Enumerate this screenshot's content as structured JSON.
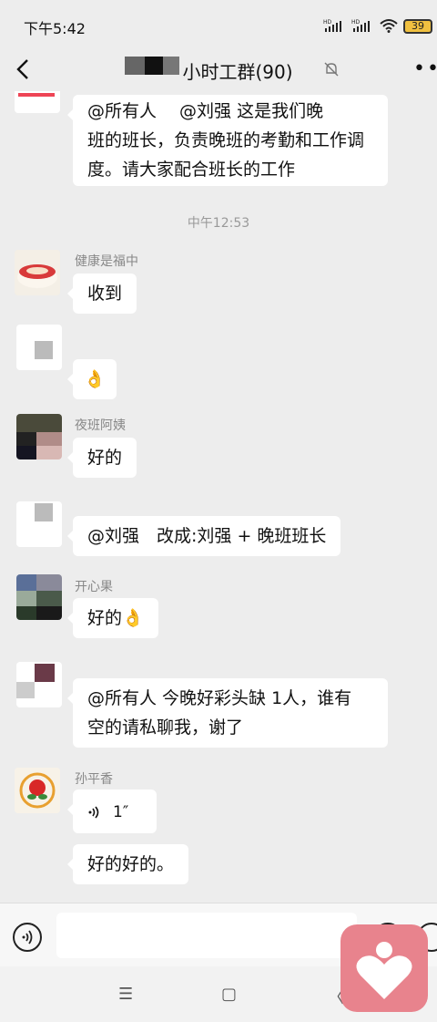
{
  "status_bar": {
    "time": "下午5:42",
    "signal1": "HD",
    "signal2": "HD",
    "battery": "39"
  },
  "header": {
    "title": "小时工群(90)"
  },
  "messages": [
    {
      "type": "text",
      "text": "@所有人　 @刘强  这是我们晚班的班长，负责晚班的考勤和工作调度。请大家配合班长的工作"
    },
    {
      "type": "time",
      "text": "中午12:53"
    },
    {
      "type": "text",
      "sender": "健康是福中",
      "text": "收到"
    },
    {
      "type": "emoji",
      "text": "👌"
    },
    {
      "type": "text",
      "sender": "夜班阿姨",
      "text": "好的"
    },
    {
      "type": "text",
      "text": "@刘强　改成:刘强 + 晚班班长"
    },
    {
      "type": "text",
      "sender": "开心果",
      "text": "好的👌"
    },
    {
      "type": "text",
      "text": "@所有人  今晚好彩头缺 1人，谁有空的请私聊我，谢了"
    },
    {
      "type": "voice",
      "sender": "孙平香",
      "duration": "1″"
    },
    {
      "type": "text",
      "text": "好的好的。"
    }
  ],
  "msg1_line1": "@所有人　 @刘强  这是我们晚",
  "msg1_line2": "班的班长，负责晚班的考勤和工作调",
  "msg1_line3": "度。请大家配合班长的工作",
  "msg8_line1": "@所有人  今晚好彩头缺 1人，谁有",
  "msg8_line2": "空的请私聊我，谢了",
  "nav": {
    "menu": "☰",
    "home": "▢",
    "back": "〈"
  },
  "colors": {
    "accent": "#e8838d",
    "bg": "#ededed",
    "bubble": "#ffffff"
  }
}
